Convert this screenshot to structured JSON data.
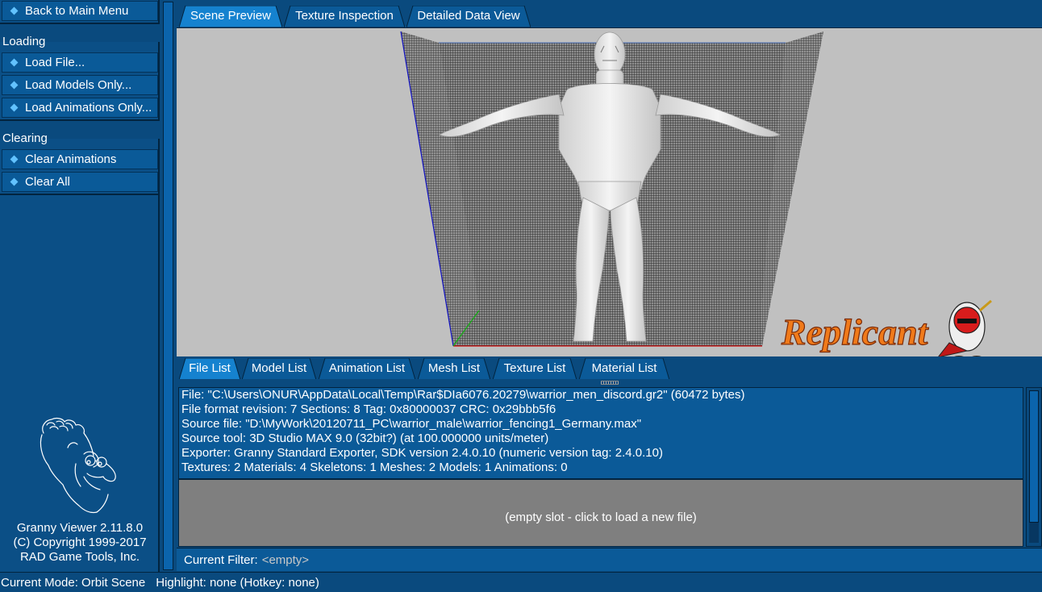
{
  "sidebar": {
    "back_button": "Back to Main Menu",
    "loading_heading": "Loading",
    "load_file": "Load File...",
    "load_models": "Load Models Only...",
    "load_animations": "Load Animations Only...",
    "clearing_heading": "Clearing",
    "clear_animations": "Clear Animations",
    "clear_all": "Clear All",
    "version": "Granny Viewer 2.11.8.0",
    "copyright": "(C) Copyright 1999-2017",
    "company": "RAD Game Tools, Inc."
  },
  "top_tabs": {
    "scene_preview": "Scene Preview",
    "texture_inspection": "Texture Inspection",
    "detailed_data_view": "Detailed Data View",
    "active": "scene_preview"
  },
  "scene": {
    "logo_text": "Replicant",
    "grid_color": "#606060",
    "background_color": "#c0c0c0"
  },
  "list_tabs": {
    "file_list": "File List",
    "model_list": "Model List",
    "animation_list": "Animation List",
    "mesh_list": "Mesh List",
    "texture_list": "Texture List",
    "material_list": "Material List",
    "active": "file_list"
  },
  "file_entry": {
    "line1": "File: \"C:\\Users\\ONUR\\AppData\\Local\\Temp\\Rar$DIa6076.20279\\warrior_men_discord.gr2\" (60472 bytes)",
    "line2": "File format revision: 7    Sections: 8    Tag: 0x80000037    CRC: 0x29bbb5f6",
    "line3": "Source file: \"D:\\MyWork\\20120711_PC\\warrior_male\\warrior_fencing1_Germany.max\"",
    "line4": "Source tool: 3D Studio MAX 9.0 (32bit?) (at 100.000000 units/meter)",
    "line5": "Exporter: Granny Standard Exporter, SDK version 2.4.0.10 (numeric version tag: 2.4.0.10)",
    "line6": "Textures: 2    Materials: 4    Skeletons: 1    Meshes: 2    Models: 1    Animations: 0"
  },
  "empty_slot": "(empty slot - click to load a new file)",
  "filter": {
    "label": "Current Filter:",
    "value": "<empty>"
  },
  "status": {
    "mode": "Current Mode: Orbit Scene",
    "highlight": "Highlight: none (Hotkey: none)"
  }
}
